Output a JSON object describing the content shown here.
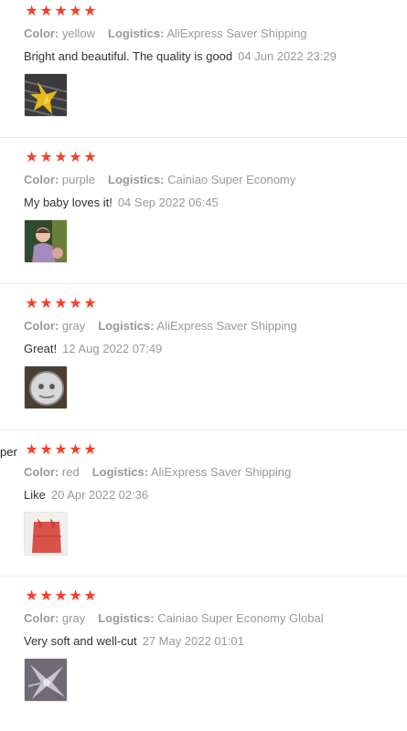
{
  "left_cut_text": "per",
  "reviews": [
    {
      "rating": 5,
      "color_label": "Color:",
      "color": "yellow",
      "logistics_label": "Logistics:",
      "logistics": "AliExpress Saver Shipping",
      "text": "Bright and beautiful. The quality is good",
      "date": "04 Jun 2022 23:29"
    },
    {
      "rating": 5,
      "color_label": "Color:",
      "color": "purple",
      "logistics_label": "Logistics:",
      "logistics": "Cainiao Super Economy",
      "text": "My baby loves it!",
      "date": "04 Sep 2022 06:45"
    },
    {
      "rating": 5,
      "color_label": "Color:",
      "color": "gray",
      "logistics_label": "Logistics:",
      "logistics": "AliExpress Saver Shipping",
      "text": "Great!",
      "date": "12 Aug 2022 07:49"
    },
    {
      "rating": 5,
      "color_label": "Color:",
      "color": "red",
      "logistics_label": "Logistics:",
      "logistics": "AliExpress Saver Shipping",
      "text": "Like",
      "date": "20 Apr 2022 02:36"
    },
    {
      "rating": 5,
      "color_label": "Color:",
      "color": "gray",
      "logistics_label": "Logistics:",
      "logistics": "Cainiao Super Economy Global",
      "text": "Very soft and well-cut",
      "date": "27 May 2022 01:01"
    }
  ],
  "colors": {
    "star": "#f5402b",
    "meta_text": "#999999",
    "body_text": "#333333",
    "divider": "#ececec"
  }
}
